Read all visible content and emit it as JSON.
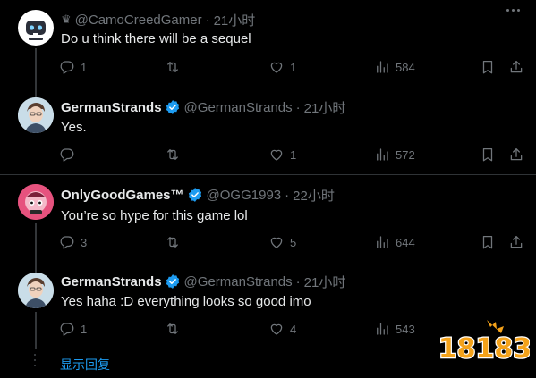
{
  "tweets": [
    {
      "handle": "@CamoCreedGamer",
      "time": "21小时",
      "text": "Do u think there will be a sequel",
      "replies": "1",
      "retweets": "",
      "likes": "1",
      "views": "584"
    },
    {
      "name": "GermanStrands",
      "handle": "@GermanStrands",
      "time": "21小时",
      "text": "Yes.",
      "replies": "",
      "retweets": "",
      "likes": "1",
      "views": "572"
    },
    {
      "name": "OnlyGoodGames™",
      "handle": "@OGG1993",
      "time": "22小时",
      "text": "You’re so hype for this game lol",
      "replies": "3",
      "retweets": "",
      "likes": "5",
      "views": "644"
    },
    {
      "name": "GermanStrands",
      "handle": "@GermanStrands",
      "time": "21小时",
      "text": "Yes haha :D everything looks so good imo",
      "replies": "1",
      "retweets": "",
      "likes": "4",
      "views": "543"
    }
  ],
  "show_replies": "显示回复",
  "watermark": "18183",
  "colors": {
    "background": "#000000",
    "text": "#e7e9ea",
    "muted": "#71767b",
    "accent": "#1d9bf0",
    "divider": "#2f3336"
  },
  "icons": [
    "crown-icon",
    "verified-icon",
    "reply-icon",
    "retweet-icon",
    "like-icon",
    "views-icon",
    "bookmark-icon",
    "share-icon",
    "more-icon"
  ]
}
